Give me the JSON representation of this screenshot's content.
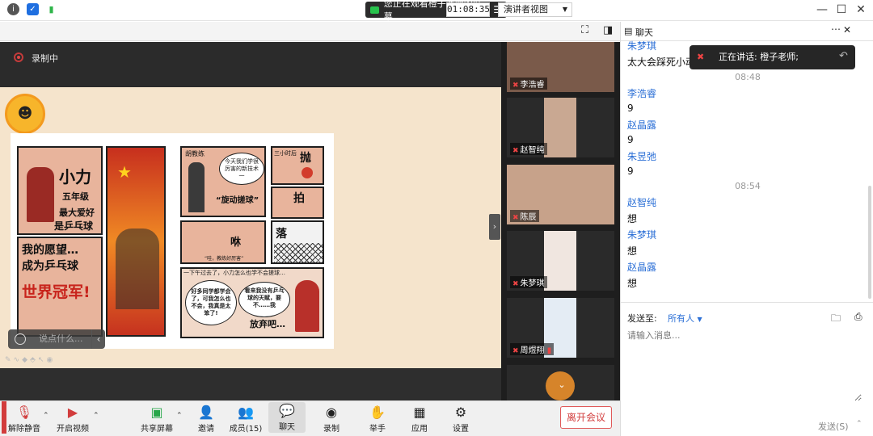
{
  "window": {
    "sharing_banner": "您正在观看橙子老师的屏幕",
    "controls": [
      "—",
      "☐",
      "✕"
    ]
  },
  "toolbar": {
    "timer": "01:08:35",
    "view_mode": "演讲者视图"
  },
  "share": {
    "recording_label": "录制中",
    "chat_pill_placeholder": "说点什么..."
  },
  "comic": {
    "title_big": "小力",
    "grade": "五年级",
    "hobby_line1": "最大爱好",
    "hobby_line2": "是乒乓球",
    "wish_line1": "我的愿望…",
    "wish_line2": "成为乒乓球",
    "champion": "世界冠军!",
    "coach_label": "胡教练",
    "coach_bubble": "今天我们学很厉害的新技术一",
    "tech_name": "“旋动搓球”",
    "three_hours": "三小时后",
    "throw": "抛",
    "hit": "拍",
    "fall": "落",
    "swish": "咻",
    "coach_praise": "“哇，教练好厉害”",
    "narration": "一下午过去了，小力怎么也学不会搓球…",
    "think1": "好多同学都学会了，可我怎么也不会，我真是太笨了!",
    "think2": "看来我没有乒乓球的天赋，要不……我",
    "give_up": "放弃吧…"
  },
  "gallery": [
    {
      "name": "李浩睿"
    },
    {
      "name": "赵智纯"
    },
    {
      "name": "陈辰"
    },
    {
      "name": "朱梦琪"
    },
    {
      "name": "周煜翔"
    }
  ],
  "chat": {
    "title": "聊天",
    "speaker_popup": "正在讲话: 橙子老师;",
    "messages": [
      {
        "name": "朱梦琪",
        "text": "太大会踩死小动"
      },
      {
        "time": "08:48"
      },
      {
        "name": "李浩睿",
        "text": "9"
      },
      {
        "name": "赵晶露",
        "text": "9"
      },
      {
        "name": "朱昱弛",
        "text": "9"
      },
      {
        "time": "08:54"
      },
      {
        "name": "赵智纯",
        "text": "想"
      },
      {
        "name": "朱梦琪",
        "text": "想"
      },
      {
        "name": "赵晶露",
        "text": "想"
      }
    ],
    "send_to_label": "发送至:",
    "send_to_value": "所有人",
    "input_placeholder": "请输入消息...",
    "send_button": "发送(S)"
  },
  "bottom": {
    "unmute": "解除静音",
    "start_video": "开启视频",
    "share_screen": "共享屏幕",
    "invite": "邀请",
    "members": "成员(15)",
    "chat": "聊天",
    "record": "录制",
    "raise_hand": "举手",
    "apps": "应用",
    "settings": "设置",
    "leave": "离开会议"
  },
  "colors": {
    "accent_blue": "#2b6fd6",
    "leave_red": "#d23c3c",
    "record_red": "#e04545"
  }
}
